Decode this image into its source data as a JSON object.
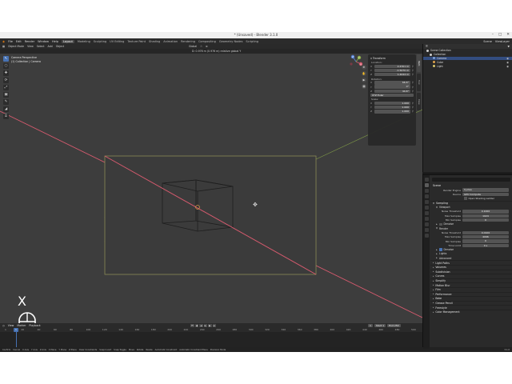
{
  "window": {
    "title": "* (Unsaved) - Blender 3.1.0",
    "controls": [
      "–",
      "□",
      "✕"
    ]
  },
  "menubar": {
    "menus": [
      "File",
      "Edit",
      "Render",
      "Window",
      "Help"
    ],
    "workspaces": [
      "Layout",
      "Modeling",
      "Sculpting",
      "UV Editing",
      "Texture Paint",
      "Shading",
      "Animation",
      "Rendering",
      "Compositing",
      "Geometry Nodes",
      "Scripting"
    ],
    "active_workspace": "Layout",
    "scene": "Scene",
    "view_layer": "ViewLayer"
  },
  "viewport_header": {
    "mode": "Object Mode",
    "menus": [
      "View",
      "Select",
      "Add",
      "Object"
    ],
    "orientation": "Global",
    "status_line": "D: 0.976 m (0.976 m) relative global Y"
  },
  "viewport": {
    "info": [
      "Camera Perspective",
      "(1) Collection | Camera"
    ],
    "tools": [
      "↖",
      "○",
      "✚",
      "⟳",
      "⤢",
      "▣",
      "✎",
      "◢",
      "⌹"
    ],
    "nav_tools": [
      "⊕",
      "✋",
      "▶",
      "▦"
    ],
    "gizmo_axes": [
      "X",
      "Y",
      "Z"
    ],
    "key_overlay": "X"
  },
  "npanel": {
    "title": "Transform",
    "location_label": "Location:",
    "location": [
      [
        "X",
        "2.4701 m"
      ],
      [
        "Y",
        "-1.5070 m"
      ],
      [
        "Z",
        "1.4044 m"
      ]
    ],
    "rotation_label": "Rotation:",
    "rotation": [
      [
        "X",
        "66.6°"
      ],
      [
        "Y",
        "0°"
      ],
      [
        "Z",
        "44.6°"
      ]
    ],
    "mode_label": "XYZ Euler",
    "scale_label": "Scale:",
    "scale": [
      [
        "X",
        "1.000"
      ],
      [
        "Y",
        "1.000"
      ],
      [
        "Z",
        "1.000"
      ]
    ],
    "tabs": [
      "Item",
      "Tool",
      "View"
    ]
  },
  "timeline": {
    "menus": [
      "View",
      "Marker",
      "Playback"
    ],
    "current_frame": "1",
    "start_label": "Start",
    "start": "1",
    "end_label": "End",
    "end": "250",
    "ruler": [
      "1",
      "20",
      "40",
      "60",
      "80",
      "100",
      "120",
      "140",
      "160",
      "180",
      "200",
      "220",
      "240",
      "260",
      "280",
      "300",
      "320",
      "340",
      "360",
      "380",
      "400",
      "420",
      "440",
      "460",
      "480",
      "500"
    ]
  },
  "statusbar": {
    "items": [
      "Confirm",
      "Cancel",
      "X Axis",
      "Y Axis",
      "Z Axis",
      "X Plane",
      "Y Plane",
      "Z Plane",
      "Clear Constraints",
      "Snap Invert",
      "Snap Toggle",
      "Move",
      "Rotate",
      "Resize",
      "Automatic Constraint",
      "Automatic Constraint Plane",
      "Precision Mode"
    ],
    "version": "3.1.0"
  },
  "outliner": {
    "items": [
      {
        "label": "Scene Collection",
        "color": "#cfcfcf",
        "selected": false
      },
      {
        "label": "Collection",
        "color": "#cfcfcf",
        "selected": false
      },
      {
        "label": "Camera",
        "color": "#7e9fd6",
        "selected": true
      },
      {
        "label": "Cube",
        "color": "#e0a24a",
        "selected": false
      },
      {
        "label": "Light",
        "color": "#d9c76c",
        "selected": false
      }
    ]
  },
  "properties": {
    "scene_title": "Scene",
    "render_engine_label": "Render Engine",
    "render_engine": "Cycles",
    "device_label": "Device",
    "device": "GPU Compute",
    "open_shading_ladder": "Open Shading Ladder",
    "sampling": "Sampling",
    "viewport": "Viewport",
    "noise_threshold_label": "Noise Threshold",
    "noise_threshold_vp": "0.1000",
    "max_samples_label": "Max Samples",
    "max_samples_vp": "1024",
    "min_samples_label": "Min Samples",
    "min_samples_vp": "0",
    "denoise": "Denoise",
    "render": "Render",
    "noise_threshold_r": "0.0100",
    "max_samples_r": "4096",
    "min_samples_r": "0",
    "time_limit_label": "Time Limit",
    "time_limit": "0 s",
    "sub_denoise": "Denoise",
    "lights": "Lights",
    "advanced": "Advanced",
    "sections": [
      "Light Paths",
      "Volumes",
      "Subdivision",
      "Curves",
      "Simplify",
      "Motion Blur",
      "Film",
      "Performance",
      "Bake",
      "Grease Pencil",
      "Freestyle",
      "Color Management"
    ]
  },
  "colors": {
    "accent": "#4772b3",
    "x_axis": "#d65a6e",
    "y_axis": "#8fb04a",
    "z_axis": "#5682d6",
    "camera_frame": "#8a8a55"
  }
}
